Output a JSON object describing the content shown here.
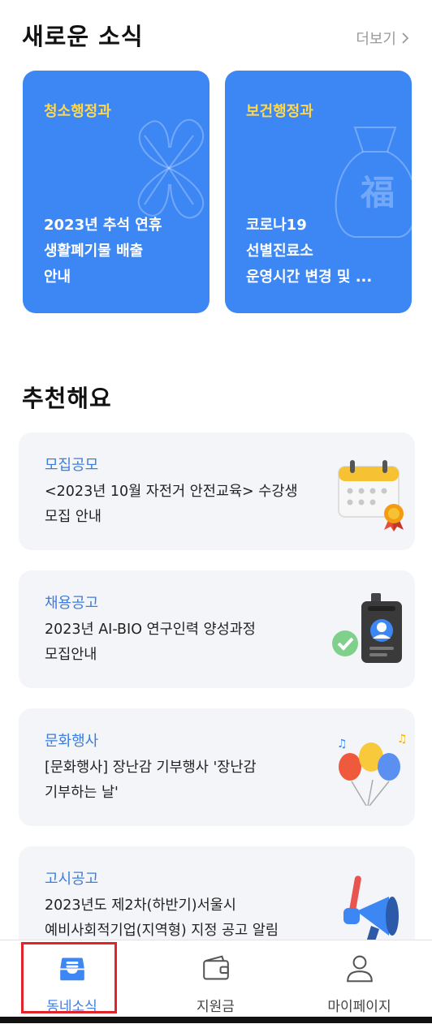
{
  "news": {
    "title": "새로운 소식",
    "more_label": "더보기",
    "cards": [
      {
        "category": "청소행정과",
        "lines": [
          "2023년 추석 연휴",
          "생활폐기물 배출",
          "안내"
        ]
      },
      {
        "category": "보건행정과",
        "lines": [
          "코로나19",
          "선별진료소",
          "운영시간 변경 및 ..."
        ],
        "badge_char": "福"
      }
    ]
  },
  "recommend": {
    "title": "추천해요",
    "items": [
      {
        "category": "모집공모",
        "lines": [
          "<2023년 10월 자전거 안전교육> 수강생",
          "모집 안내"
        ],
        "icon": "calendar-icon"
      },
      {
        "category": "채용공고",
        "lines": [
          "2023년 AI-BIO 연구인력 양성과정",
          "모집안내"
        ],
        "icon": "id-badge-icon"
      },
      {
        "category": "문화행사",
        "lines": [
          "[문화행사] 장난감 기부행사 '장난감",
          "기부하는 날'"
        ],
        "icon": "balloons-icon"
      },
      {
        "category": "고시공고",
        "lines": [
          "2023년도 제2차(하반기)서울시",
          "예비사회적기업(지역형) 지정 공고 알림"
        ],
        "icon": "megaphone-icon"
      }
    ]
  },
  "nav": {
    "items": [
      {
        "label": "동네소식",
        "icon": "inbox-icon",
        "active": true
      },
      {
        "label": "지원금",
        "icon": "wallet-icon",
        "active": false
      },
      {
        "label": "마이페이지",
        "icon": "person-icon",
        "active": false
      }
    ]
  },
  "colors": {
    "accent": "#3d87f5",
    "category_yellow": "#ffd84a",
    "link_blue": "#3b7de0",
    "highlight_red": "#e3232a"
  }
}
